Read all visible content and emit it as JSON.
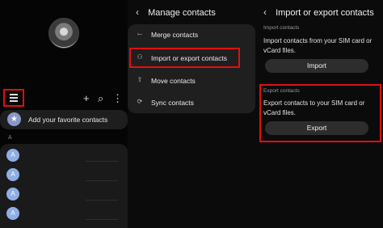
{
  "contacts_panel": {
    "fav_label": "Add your favorite contacts",
    "section_letter": "A",
    "avatar_letter": "A",
    "top_icons": {
      "add": "+",
      "search": "⌕",
      "more": "⋮"
    }
  },
  "manage_panel": {
    "back": "‹",
    "title": "Manage contacts",
    "items": [
      {
        "label": "Merge contacts",
        "icon": "merge-icon"
      },
      {
        "label": "Import or export contacts",
        "icon": "import-export-icon"
      },
      {
        "label": "Move contacts",
        "icon": "move-icon"
      },
      {
        "label": "Sync contacts",
        "icon": "sync-icon"
      }
    ]
  },
  "import_export_panel": {
    "back": "‹",
    "title": "Import or export contacts",
    "import": {
      "section": "Import contacts",
      "description": "Import contacts from your SIM card or vCard files.",
      "button": "Import"
    },
    "export": {
      "section": "Export contacts",
      "description": "Export contacts to your SIM card or vCard files.",
      "button": "Export"
    }
  },
  "colors": {
    "highlight": "#e01010",
    "avatar": "#8faee6",
    "card": "#1f1f1f"
  }
}
